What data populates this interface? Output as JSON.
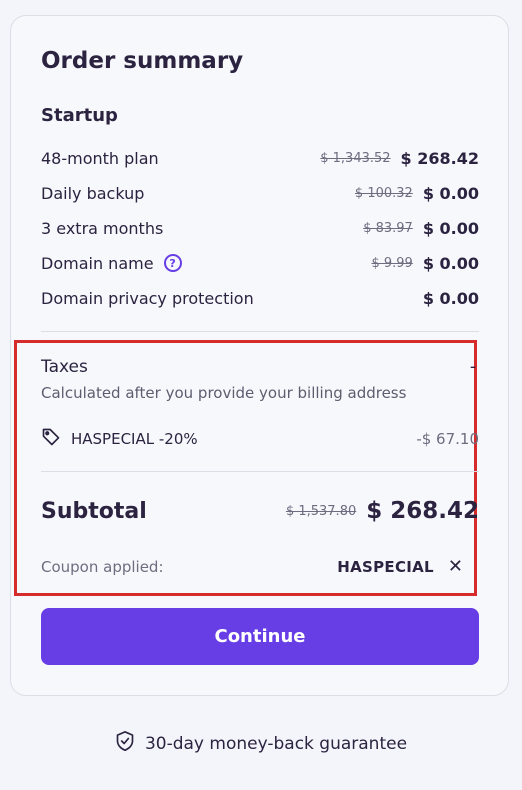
{
  "summary": {
    "title": "Order summary",
    "plan_name": "Startup",
    "items": [
      {
        "label": "48-month plan",
        "old_price": "$ 1,343.52",
        "new_price": "$ 268.42"
      },
      {
        "label": "Daily backup",
        "old_price": "$ 100.32",
        "new_price": "$ 0.00"
      },
      {
        "label": "3 extra months",
        "old_price": "$ 83.97",
        "new_price": "$ 0.00"
      },
      {
        "label": "Domain name",
        "old_price": "$ 9.99",
        "new_price": "$ 0.00",
        "help_icon": "question-circle-icon",
        "help_glyph": "?"
      },
      {
        "label": "Domain privacy protection",
        "new_price": "$ 0.00"
      }
    ]
  },
  "taxes": {
    "label": "Taxes",
    "value": "-",
    "note": "Calculated after you provide your billing address"
  },
  "coupon": {
    "icon": "tag-icon",
    "label": "HASPECIAL -20%",
    "discount": "-$ 67.10"
  },
  "subtotal": {
    "label": "Subtotal",
    "old_price": "$ 1,537.80",
    "new_price": "$ 268.42"
  },
  "applied": {
    "label": "Coupon applied:",
    "code": "HASPECIAL",
    "remove_glyph": "✕"
  },
  "continue_label": "Continue",
  "guarantee": {
    "icon": "shield-check-icon",
    "text": "30-day money-back guarantee"
  },
  "colors": {
    "accent": "#673de6",
    "highlight_border": "#d62b2b",
    "text": "#2b2340"
  }
}
